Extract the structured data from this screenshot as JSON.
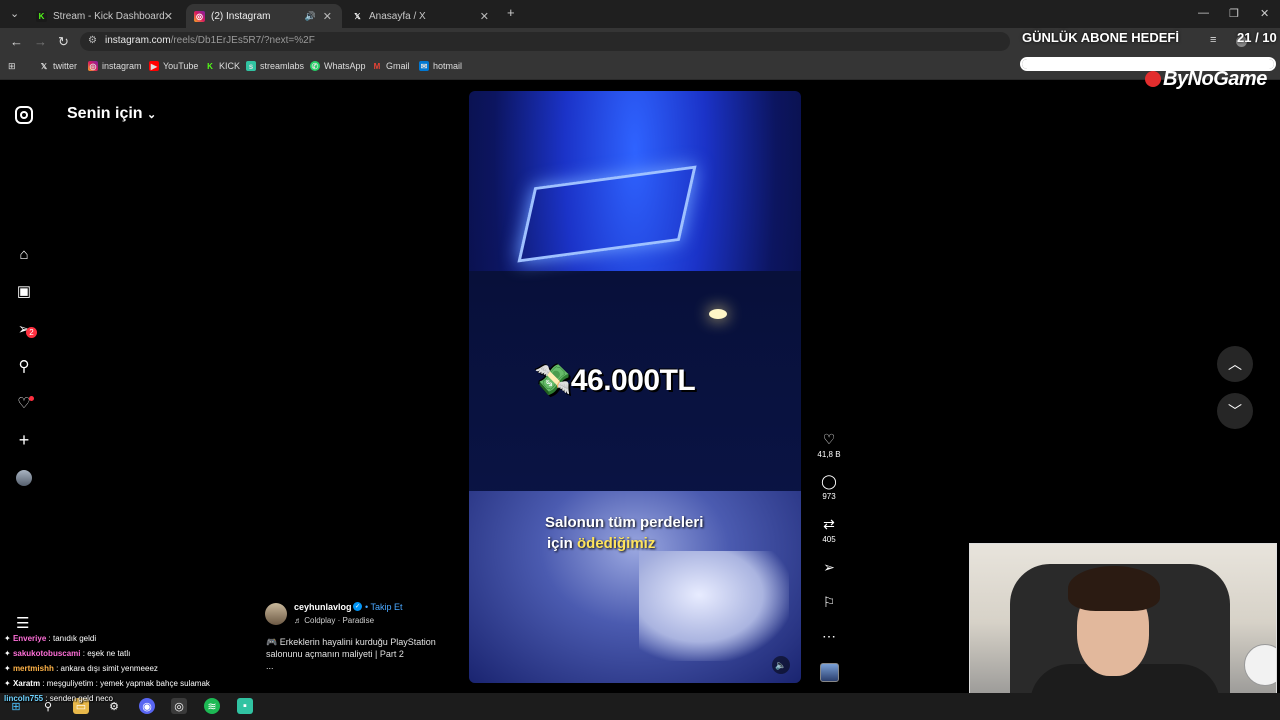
{
  "browser": {
    "tabs": [
      {
        "label": "Stream - Kick Dashboard",
        "icon": "kick-icon"
      },
      {
        "label": "(2) Instagram",
        "icon": "instagram-icon"
      },
      {
        "label": "Anasayfa / X",
        "icon": "x-icon"
      }
    ],
    "new_tab": "+",
    "url_main": "instagram.com",
    "url_rest": "/reels/Db1ErJEs5R7/?next=%2F",
    "bookmarks": [
      {
        "label": "twitter",
        "icon": "x-icon"
      },
      {
        "label": "instagram",
        "icon": "instagram-icon"
      },
      {
        "label": "YouTube",
        "icon": "youtube-icon"
      },
      {
        "label": "KICK",
        "icon": "kick-icon"
      },
      {
        "label": "streamlabs",
        "icon": "streamlabs-icon"
      },
      {
        "label": "WhatsApp",
        "icon": "whatsapp-icon"
      },
      {
        "label": "Gmail",
        "icon": "gmail-icon"
      },
      {
        "label": "hotmail",
        "icon": "hotmail-icon"
      }
    ]
  },
  "overlay": {
    "title": "GÜNLÜK ABONE HEDEFİ",
    "count": "21 / 10",
    "progress": 1.0,
    "brand": "ByNoGame"
  },
  "instagram": {
    "feed_title": "Senin için",
    "notif_count": "2",
    "video": {
      "price_text": "💸46.000TL",
      "caption_line1": "Salonun tüm perdeleri",
      "caption_line2_a": "için ",
      "caption_line2_b": "ödediğimiz"
    },
    "post": {
      "author": "ceyhunlavlog",
      "follow": "• Takip Et",
      "music": "♬ Coldplay · Paradise",
      "desc_line1": "🎮 Erkeklerin hayalini kurduğu PlayStation",
      "desc_line2": "salonunu açmanın maliyeti | Part 2",
      "desc_more": "..."
    },
    "actions": {
      "likes": "41,8 B",
      "comments": "973",
      "reposts": "405"
    }
  },
  "chat": [
    {
      "user": "Enveriye",
      "msg": ": tanıdık geldi",
      "color": "#ff6fd8"
    },
    {
      "user": "sakukotobuscami",
      "msg": ": eşek ne tatlı",
      "color": "#ff6fd8"
    },
    {
      "user": "mertmishh",
      "msg": ": ankara dışı simit yenmeeez",
      "color": "#ffb347"
    },
    {
      "user": "Xaratm",
      "msg": ": meşguliyetim : yemek yapmak bahçe sulamak",
      "color": "#ffffff"
    },
    {
      "user": "lincoln755",
      "msg": ": senden geld neco",
      "color": "#6fd3ff"
    }
  ]
}
